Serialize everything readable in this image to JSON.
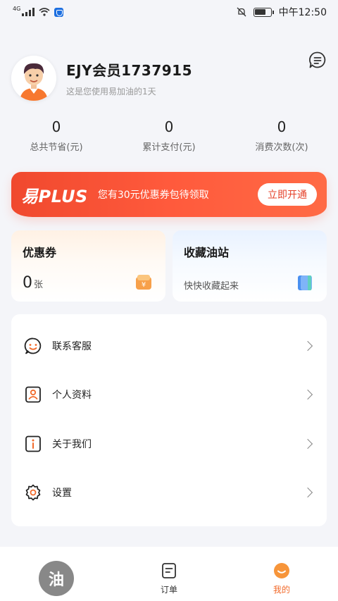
{
  "statusbar": {
    "network": "4G",
    "time": "中午12:50"
  },
  "profile": {
    "name": "EJY会员1737915",
    "subtitle": "这是您使用易加油的1天"
  },
  "stats": [
    {
      "value": "0",
      "label": "总共节省(元)"
    },
    {
      "value": "0",
      "label": "累计支付(元)"
    },
    {
      "value": "0",
      "label": "消费次数(次)"
    }
  ],
  "plus_banner": {
    "logo": "易PLUS",
    "text": "您有30元优惠券包待领取",
    "button": "立即开通"
  },
  "cards": {
    "coupon": {
      "title": "优惠券",
      "count": "0",
      "unit": "张"
    },
    "favorites": {
      "title": "收藏油站",
      "desc": "快快收藏起来"
    }
  },
  "menu": [
    {
      "label": "联系客服",
      "icon": "customer-service-icon"
    },
    {
      "label": "个人资料",
      "icon": "profile-card-icon"
    },
    {
      "label": "关于我们",
      "icon": "info-icon"
    },
    {
      "label": "设置",
      "icon": "gear-icon"
    }
  ],
  "tabbar": [
    {
      "label": "",
      "icon": "refuel-icon",
      "glyph": "油"
    },
    {
      "label": "订单",
      "icon": "order-icon"
    },
    {
      "label": "我的",
      "icon": "mine-icon",
      "active": true
    }
  ],
  "colors": {
    "accent": "#f26a2a",
    "banner_red": "#f0492e",
    "page_bg": "#f4f5f9"
  }
}
